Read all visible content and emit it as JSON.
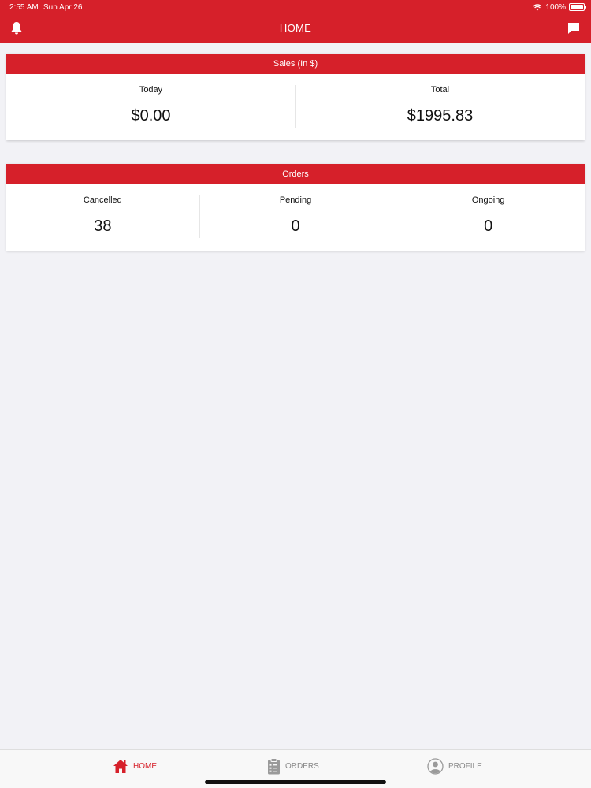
{
  "status_bar": {
    "time": "2:55 AM",
    "date": "Sun Apr 26",
    "battery": "100%"
  },
  "nav": {
    "title": "HOME"
  },
  "sales": {
    "header": "Sales (In $)",
    "today_label": "Today",
    "today_value": "$0.00",
    "total_label": "Total",
    "total_value": "$1995.83"
  },
  "orders": {
    "header": "Orders",
    "cancelled_label": "Cancelled",
    "cancelled_value": "38",
    "pending_label": "Pending",
    "pending_value": "0",
    "ongoing_label": "Ongoing",
    "ongoing_value": "0"
  },
  "tabs": [
    {
      "label": "HOME",
      "icon": "home-icon",
      "active": true
    },
    {
      "label": "ORDERS",
      "icon": "clipboard-icon",
      "active": false
    },
    {
      "label": "PROFILE",
      "icon": "user-circle-icon",
      "active": false
    }
  ],
  "colors": {
    "accent": "#d6202a",
    "background": "#f2f2f6",
    "inactive": "#888888"
  }
}
